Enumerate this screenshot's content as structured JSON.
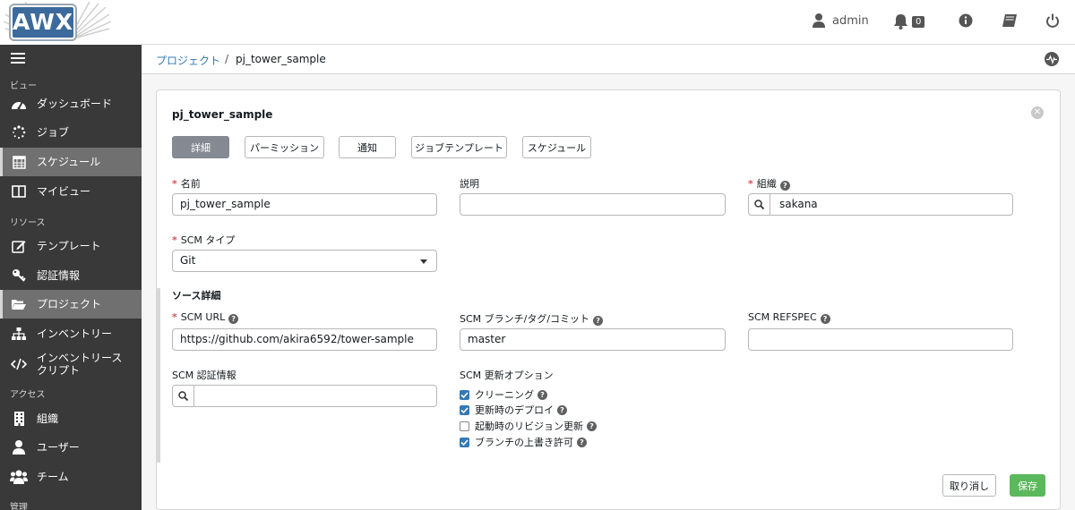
{
  "header": {
    "logo_text": "AWX",
    "user": "admin",
    "notification_count": "0"
  },
  "sidebar": {
    "sections": {
      "views": "ビュー",
      "resources": "リソース",
      "access": "アクセス",
      "admin": "管理"
    },
    "items": [
      {
        "label": "ダッシュボード",
        "icon": "dashboard-icon"
      },
      {
        "label": "ジョブ",
        "icon": "spinner-icon"
      },
      {
        "label": "スケジュール",
        "icon": "calendar-icon",
        "active": true
      },
      {
        "label": "マイビュー",
        "icon": "columns-icon"
      },
      {
        "label": "テンプレート",
        "icon": "edit-icon"
      },
      {
        "label": "認証情報",
        "icon": "key-icon"
      },
      {
        "label": "プロジェクト",
        "icon": "folder-open-icon",
        "active": true
      },
      {
        "label": "インベントリー",
        "icon": "sitemap-icon"
      },
      {
        "label": "インベントリースクリプト",
        "icon": "code-icon"
      },
      {
        "label": "組織",
        "icon": "building-icon"
      },
      {
        "label": "ユーザー",
        "icon": "user-icon"
      },
      {
        "label": "チーム",
        "icon": "users-icon"
      }
    ]
  },
  "breadcrumb": {
    "parent": "プロジェクト",
    "separator": "/",
    "current": "pj_tower_sample"
  },
  "panel": {
    "title": "pj_tower_sample",
    "tabs": [
      "詳細",
      "パーミッション",
      "通知",
      "ジョブテンプレート",
      "スケジュール"
    ],
    "active_tab": "詳細",
    "fields": {
      "name_label": "名前",
      "name_value": "pj_tower_sample",
      "description_label": "説明",
      "description_value": "",
      "org_label": "組織",
      "org_value": "sakana",
      "scm_type_label": "SCM タイプ",
      "scm_type_value": "Git",
      "source_details_title": "ソース詳細",
      "scm_url_label": "SCM URL",
      "scm_url_value": "https://github.com/akira6592/tower-sample",
      "scm_branch_label": "SCM ブランチ/タグ/コミット",
      "scm_branch_value": "master",
      "scm_refspec_label": "SCM REFSPEC",
      "scm_refspec_value": "",
      "scm_credential_label": "SCM 認証情報",
      "scm_credential_value": "",
      "scm_update_options_label": "SCM 更新オプション"
    },
    "update_options": [
      {
        "label": "クリーニング",
        "checked": true
      },
      {
        "label": "更新時のデプロイ",
        "checked": true
      },
      {
        "label": "起動時のリビジョン更新",
        "checked": false
      },
      {
        "label": "ブランチの上書き許可",
        "checked": true
      }
    ],
    "buttons": {
      "cancel": "取り消し",
      "save": "保存"
    }
  },
  "colors": {
    "sidebar_bg": "#393939",
    "sidebar_active": "#707070",
    "link": "#337ab7",
    "save": "#5cb85c",
    "tab_active": "#848992",
    "required": "#d9534f"
  }
}
